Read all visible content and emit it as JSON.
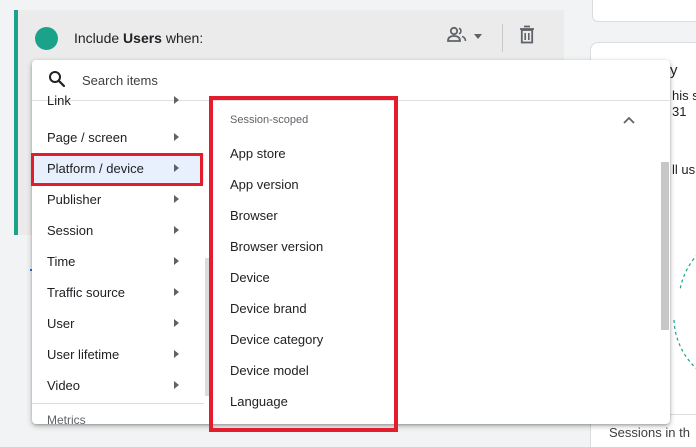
{
  "condition": {
    "title_prefix": "Include ",
    "title_bold": "Users",
    "title_suffix": " when:",
    "scope_icon": "users-scope-icon",
    "delete_icon": "trash-icon",
    "accent_color": "#1aa28a"
  },
  "right_panel": {
    "title_fragment": "y",
    "line1_fragment": "his s",
    "line2_fragment": "31",
    "line3_fragment": "ll us",
    "footer_text": "Sessions in th"
  },
  "dropdown": {
    "search": {
      "placeholder": "Search items",
      "value": ""
    },
    "categories": [
      {
        "label": "Link"
      },
      {
        "label": "Page / screen"
      },
      {
        "label": "Platform / device",
        "selected": true
      },
      {
        "label": "Publisher"
      },
      {
        "label": "Session"
      },
      {
        "label": "Time"
      },
      {
        "label": "Traffic source"
      },
      {
        "label": "User"
      },
      {
        "label": "User lifetime"
      },
      {
        "label": "Video"
      }
    ],
    "next_section_peek": "Metrics",
    "group": {
      "header": "Session-scoped",
      "items": [
        {
          "label": "App store"
        },
        {
          "label": "App version"
        },
        {
          "label": "Browser"
        },
        {
          "label": "Browser version"
        },
        {
          "label": "Device"
        },
        {
          "label": "Device brand"
        },
        {
          "label": "Device category"
        },
        {
          "label": "Device model"
        },
        {
          "label": "Language"
        }
      ]
    }
  },
  "colors": {
    "annotation_red": "#e41d2d",
    "selected_bg": "#e8f0fe",
    "accent_green": "#1aa28a"
  }
}
